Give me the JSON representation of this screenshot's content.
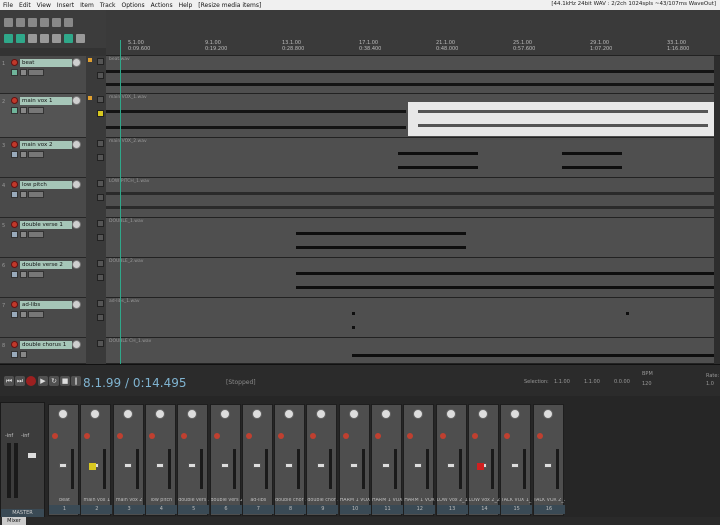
{
  "menubar": {
    "items": [
      "File",
      "Edit",
      "View",
      "Insert",
      "Item",
      "Track",
      "Options",
      "Actions",
      "Help"
    ],
    "action_hint": "[Resize media items]",
    "status": "[44.1kHz 24bit WAV : 2/2ch 1024spls ~43/107ms WaveOut]"
  },
  "ruler": {
    "marks": [
      "5.1.00",
      "9.1.00",
      "13.1.00",
      "17.1.00",
      "21.1.00",
      "25.1.00",
      "29.1.00",
      "33.1.00"
    ],
    "times": [
      "0:09.600",
      "0:19.200",
      "0:28.800",
      "0:38.400",
      "0:48.000",
      "0:57.600",
      "1:07.200",
      "1:16.800"
    ]
  },
  "tracks": [
    {
      "num": "1",
      "name": "beat",
      "item": "beat.wav"
    },
    {
      "num": "2",
      "name": "main vox 1",
      "item": "main VOX_1.wav"
    },
    {
      "num": "3",
      "name": "main vox 2",
      "item": "main VOX_2.wav"
    },
    {
      "num": "4",
      "name": "low pitch",
      "item": "LOW PITCH_1.wav"
    },
    {
      "num": "5",
      "name": "double verse 1",
      "item": "DOUBLE_1.wav"
    },
    {
      "num": "6",
      "name": "double verse 2",
      "item": "DOUBLE_2.wav"
    },
    {
      "num": "7",
      "name": "ad-libs",
      "item": "ad-libs_1.wav"
    },
    {
      "num": "8",
      "name": "double chorus 1",
      "item": "DOUBLE CH_1.wav"
    }
  ],
  "transport": {
    "position": "8.1.99 / 0:14.495",
    "state": "[Stopped]",
    "selection_label": "Selection:",
    "sel_start": "1.1.00",
    "sel_end": "1.1.00",
    "sel_len": "0.0.00",
    "bpm_label": "BPM",
    "bpm": "120",
    "rate_label": "Rate:",
    "rate": "1.0"
  },
  "mixer": {
    "master_label": "MASTER",
    "master_db_l": "-inf",
    "master_db_r": "-inf",
    "strips": [
      {
        "label": "beat",
        "num": "1"
      },
      {
        "label": "main vox 1",
        "num": "2"
      },
      {
        "label": "main vox 2",
        "num": "3"
      },
      {
        "label": "low pitch",
        "num": "4"
      },
      {
        "label": "double vers 1",
        "num": "5"
      },
      {
        "label": "double vers 2",
        "num": "6"
      },
      {
        "label": "ad-libs",
        "num": "7"
      },
      {
        "label": "double chor 1",
        "num": "8"
      },
      {
        "label": "double chor 2",
        "num": "9"
      },
      {
        "label": "HARM 1 VOX 1",
        "num": "10"
      },
      {
        "label": "HARM 1 VOX 2",
        "num": "11"
      },
      {
        "label": "HARM 1 VOX 3",
        "num": "12"
      },
      {
        "label": "LOW vox 2_1",
        "num": "13"
      },
      {
        "label": "LOW vox 2_2",
        "num": "14"
      },
      {
        "label": "TALK VOX 1_1",
        "num": "15"
      },
      {
        "label": "TALK VOX 2_1",
        "num": "16"
      }
    ]
  },
  "footer": {
    "tab": "Mixer"
  },
  "colors": {
    "accent": "#2fa88a",
    "record": "#c0392b",
    "track_name_bg": "#a6c6b8",
    "selected_item": "#e8e8e8"
  }
}
